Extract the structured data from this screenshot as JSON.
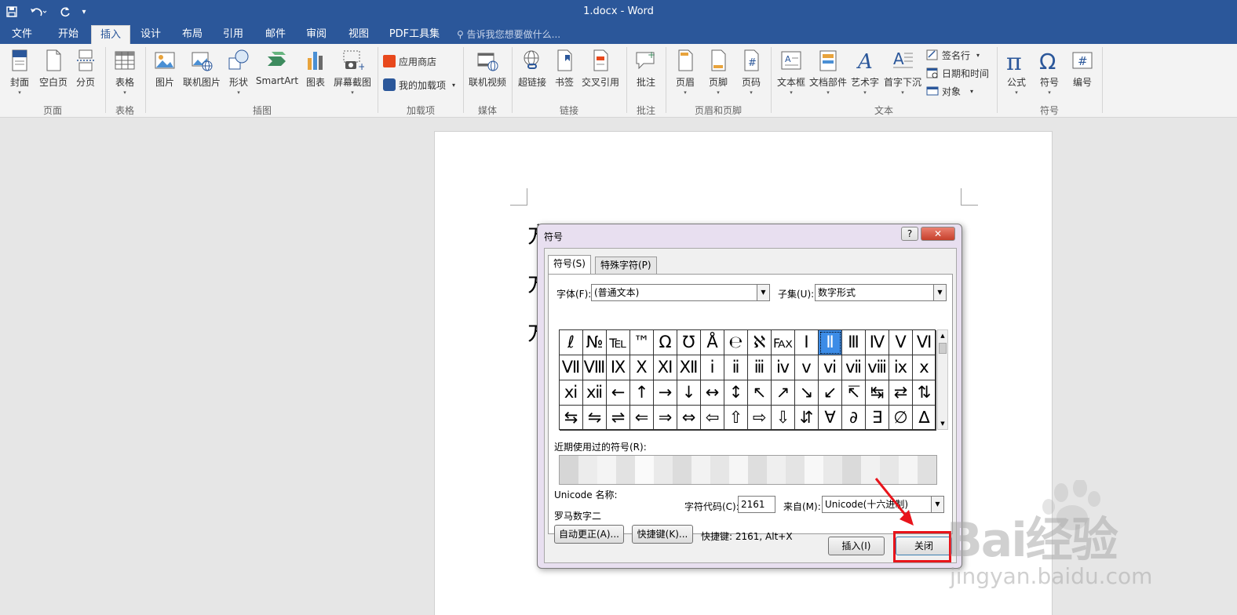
{
  "titlebar": {
    "title": "1.docx - Word",
    "save_icon": "save-icon",
    "undo_icon": "undo-icon",
    "redo_icon": "redo-icon",
    "customize_icon": "customize-icon",
    "bg_color": "#2b579a"
  },
  "tabs": [
    {
      "label": "文件"
    },
    {
      "label": "开始"
    },
    {
      "label": "插入"
    },
    {
      "label": "设计"
    },
    {
      "label": "布局"
    },
    {
      "label": "引用"
    },
    {
      "label": "邮件"
    },
    {
      "label": "审阅"
    },
    {
      "label": "视图"
    },
    {
      "label": "PDF工具集"
    }
  ],
  "active_tab": "插入",
  "tell_me": "告诉我您想要做什么...",
  "ribbon": {
    "buttons": {
      "cover": "封面",
      "blank_page": "空白页",
      "page_break": "分页",
      "table": "表格",
      "picture": "图片",
      "online_picture": "联机图片",
      "shapes": "形状",
      "smartart": "SmartArt",
      "chart": "图表",
      "screenshot": "屏幕截图",
      "app_store": "应用商店",
      "my_addins": "我的加载项",
      "online_video": "联机视频",
      "hyperlink": "超链接",
      "bookmark": "书签",
      "cross_ref": "交叉引用",
      "comment": "批注",
      "header": "页眉",
      "footer": "页脚",
      "page_number": "页码",
      "textbox": "文本框",
      "quick_parts": "文档部件",
      "wordart": "艺术字",
      "dropcap": "首字下沉",
      "signature_line": "签名行",
      "date_time": "日期和时间",
      "object": "对象",
      "equation": "公式",
      "symbol": "符号",
      "number": "编号"
    },
    "groups": {
      "pages": "页面",
      "tables": "表格",
      "illustrations": "插图",
      "addins": "加载项",
      "media": "媒体",
      "links": "链接",
      "comments": "批注",
      "header_footer": "页眉和页脚",
      "text": "文本",
      "symbols": "符号"
    }
  },
  "document": {
    "visible_chars": [
      "方",
      "方",
      "方"
    ]
  },
  "dialog": {
    "title": "符号",
    "help_button": "?",
    "close_x": "✕",
    "tab_symbols": "符号(S)",
    "tab_special": "特殊字符(P)",
    "font_label": "字体(F):",
    "font_value": "(普通文本)",
    "subset_label": "子集(U):",
    "subset_value": "数字形式",
    "symbols": [
      "ℓ",
      "№",
      "℡",
      "™",
      "Ω",
      "℧",
      "Å",
      "℮",
      "ℵ",
      "℻",
      "Ⅰ",
      "Ⅱ",
      "Ⅲ",
      "Ⅳ",
      "Ⅴ",
      "Ⅵ",
      "Ⅶ",
      "Ⅷ",
      "Ⅸ",
      "Ⅹ",
      "Ⅺ",
      "Ⅻ",
      "ⅰ",
      "ⅱ",
      "ⅲ",
      "ⅳ",
      "ⅴ",
      "ⅵ",
      "ⅶ",
      "ⅷ",
      "ⅸ",
      "ⅹ",
      "ⅺ",
      "ⅻ",
      "←",
      "↑",
      "→",
      "↓",
      "↔",
      "↕",
      "↖",
      "↗",
      "↘",
      "↙",
      "↸",
      "↹",
      "⇄",
      "⇅",
      "⇆",
      "⇋",
      "⇌",
      "⇐",
      "⇒",
      "⇔",
      "⇦",
      "⇧",
      "⇨",
      "⇩",
      "⇵",
      "∀",
      "∂",
      "∃",
      "∅",
      "∆"
    ],
    "selected_symbol": "Ⅱ",
    "recent_label": "近期使用过的符号(R):",
    "unicode_name_label": "Unicode 名称:",
    "unicode_name_value": "罗马数字二",
    "char_code_label": "字符代码(C):",
    "char_code_value": "2161",
    "from_label": "来自(M):",
    "from_value": "Unicode(十六进制)",
    "autocorrect_button": "自动更正(A)...",
    "shortcut_button": "快捷键(K)...",
    "shortcut_text": "快捷键: 2161, Alt+X",
    "insert_button": "插入(I)",
    "close_button": "关闭",
    "selection_color": "#3c8ce7"
  },
  "annotation": {
    "highlight_color": "#e8141b"
  },
  "watermark": {
    "text": "Bai经验",
    "url": "jingyan.baidu.com"
  }
}
